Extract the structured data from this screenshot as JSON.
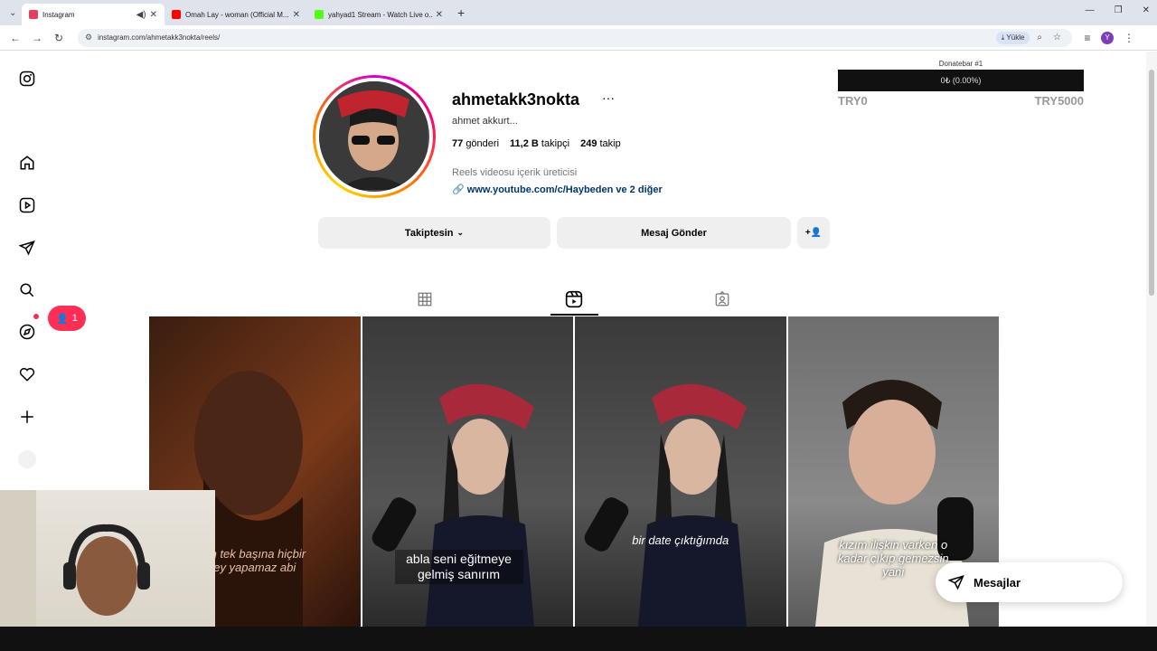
{
  "browser": {
    "tabs": [
      {
        "title": "Instagram",
        "favicon_color": "#e4405f",
        "active": true
      },
      {
        "title": "Omah Lay - woman (Official M...",
        "favicon_color": "#ff0000",
        "active": false
      },
      {
        "title": "yahyad1 Stream - Watch Live o...",
        "favicon_color": "#53fc18",
        "active": false
      }
    ],
    "url": "instagram.com/ahmetakk3nokta/reels/",
    "download_label": "Yükle",
    "profile_initial": "Y"
  },
  "profile": {
    "username": "ahmetakk3nokta",
    "full_name": "ahmet akkurt...",
    "stats": {
      "posts_value": "77",
      "posts_label": "gönderi",
      "followers_value": "11,2 B",
      "followers_label": "takipçi",
      "following_value": "249",
      "following_label": "takip"
    },
    "category": "Reels videosu içerik üreticisi",
    "link": "www.youtube.com/c/Haybeden ve 2 diğer",
    "buttons": {
      "following": "Takiptesin",
      "message": "Mesaj Gönder"
    }
  },
  "notifications": {
    "count": "1"
  },
  "donation": {
    "title": "Donatebar #1",
    "progress_text": "0₺ (0.00%)",
    "progress": 0,
    "min": "TRY0",
    "max": "TRY5000"
  },
  "reels": [
    {
      "caption": "en tek başına hiçbir\ney yapamaz abi"
    },
    {
      "caption": "abla seni eğitmeye\ngelmiş sanırım"
    },
    {
      "caption": "bir date çıktığımda"
    },
    {
      "caption": "kızım ilişkin varken o\nkadar çıkıp gemezsin\nyani"
    }
  ],
  "messages_label": "Mesajlar"
}
